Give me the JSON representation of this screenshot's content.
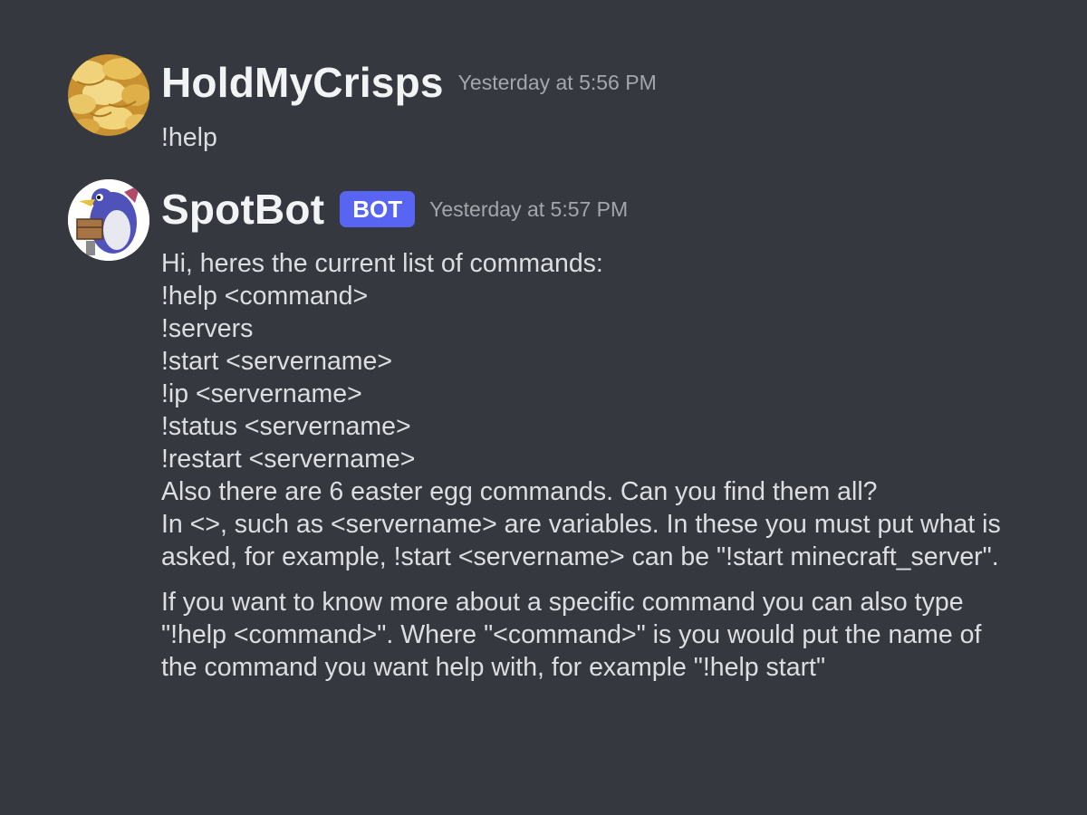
{
  "messages": [
    {
      "author": "HoldMyCrisps",
      "timestamp": "Yesterday at 5:56 PM",
      "text": "!help",
      "avatar_icon": "crisps-avatar"
    },
    {
      "author": "SpotBot",
      "badge": "BOT",
      "timestamp": "Yesterday at 5:57 PM",
      "avatar_icon": "penguin-bot-avatar",
      "lines": [
        "Hi, heres the current list of commands:",
        "!help <command>",
        "!servers",
        "!start <servername>",
        "!ip <servername>",
        "!status <servername>",
        "!restart <servername>",
        "Also there are 6 easter egg commands. Can you find them all?"
      ],
      "paragraph_1_tail": "In <>, such as <servername> are variables. In these you must put what is asked, for example, !start <servername> can be \"!start minecraft_server\".",
      "paragraph_2": "If you want to know more about a specific command you can also type \"!help <command>\". Where \"<command>\" is you would put the name of the command you want help with, for example \"!help start\""
    }
  ],
  "colors": {
    "background": "#36383f",
    "badge": "#5865f2",
    "text": "#dcdee1",
    "timestamp": "#a3a6aa"
  }
}
